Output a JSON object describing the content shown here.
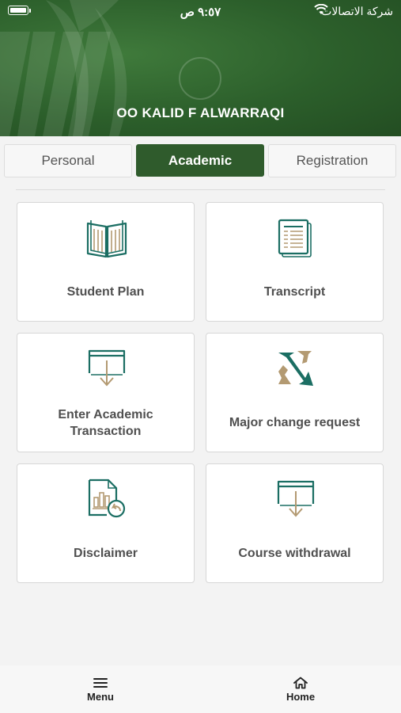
{
  "status_bar": {
    "time": "٩:٥٧ ص",
    "carrier": "شركة الاتصالات"
  },
  "header": {
    "student_name": "OO KALID F ALWARRAQI"
  },
  "tabs": [
    {
      "label": "Personal",
      "active": false
    },
    {
      "label": "Academic",
      "active": true
    },
    {
      "label": "Registration",
      "active": false
    }
  ],
  "tiles": [
    {
      "label": "Student Plan",
      "icon": "open-book-icon"
    },
    {
      "label": "Transcript",
      "icon": "document-stack-icon"
    },
    {
      "label": "Enter Academic Transaction",
      "icon": "window-arrow-down-icon"
    },
    {
      "label": "Major change request",
      "icon": "swap-arrows-icon"
    },
    {
      "label": "Disclaimer",
      "icon": "report-undo-icon"
    },
    {
      "label": "Course withdrawal",
      "icon": "window-arrow-down-icon"
    }
  ],
  "bottom_nav": {
    "menu_label": "Menu",
    "home_label": "Home"
  },
  "colors": {
    "brand_green": "#2f5b2c",
    "icon_teal": "#1b6e63",
    "icon_tan": "#b39a72"
  }
}
